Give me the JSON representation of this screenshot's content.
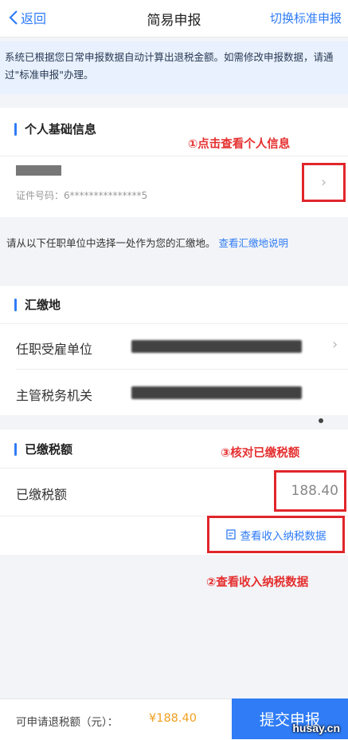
{
  "header": {
    "back_label": "返回",
    "title": "简易申报",
    "switch_label": "切换标准申报"
  },
  "notice": {
    "text": "系统已根据您日常申报数据自动计算出退税金额。如需修改申报数据，请通过\"标准申报\"办理。"
  },
  "personal": {
    "section_title": "个人基础信息",
    "annotation": "①点击查看个人信息",
    "id_label": "证件号码：",
    "id_value": "6***************5"
  },
  "hint": {
    "text": "请从以下任职单位中选择一处作为您的汇缴地。",
    "link": "查看汇缴地说明"
  },
  "huijiao": {
    "section_title": "汇缴地",
    "employer_label": "任职受雇单位",
    "tax_office_label": "主管税务机关"
  },
  "paid": {
    "section_title": "已缴税额",
    "annotation": "③核对已缴税额",
    "row_label": "已缴税额",
    "amount": "188.40",
    "view_income_link": "查看收入纳税数据",
    "annotation2": "②查看收入纳税数据"
  },
  "footer": {
    "refund_label": "可申请退税额（元）：",
    "refund_amount": "¥188.40",
    "submit_label": "提交申报"
  },
  "watermark": "husay.cn",
  "colors": {
    "accent": "#2f7cf6",
    "annotation_red": "#e0262b",
    "notice_bg": "#e8f1fd",
    "refund_amount": "#f0a020"
  }
}
